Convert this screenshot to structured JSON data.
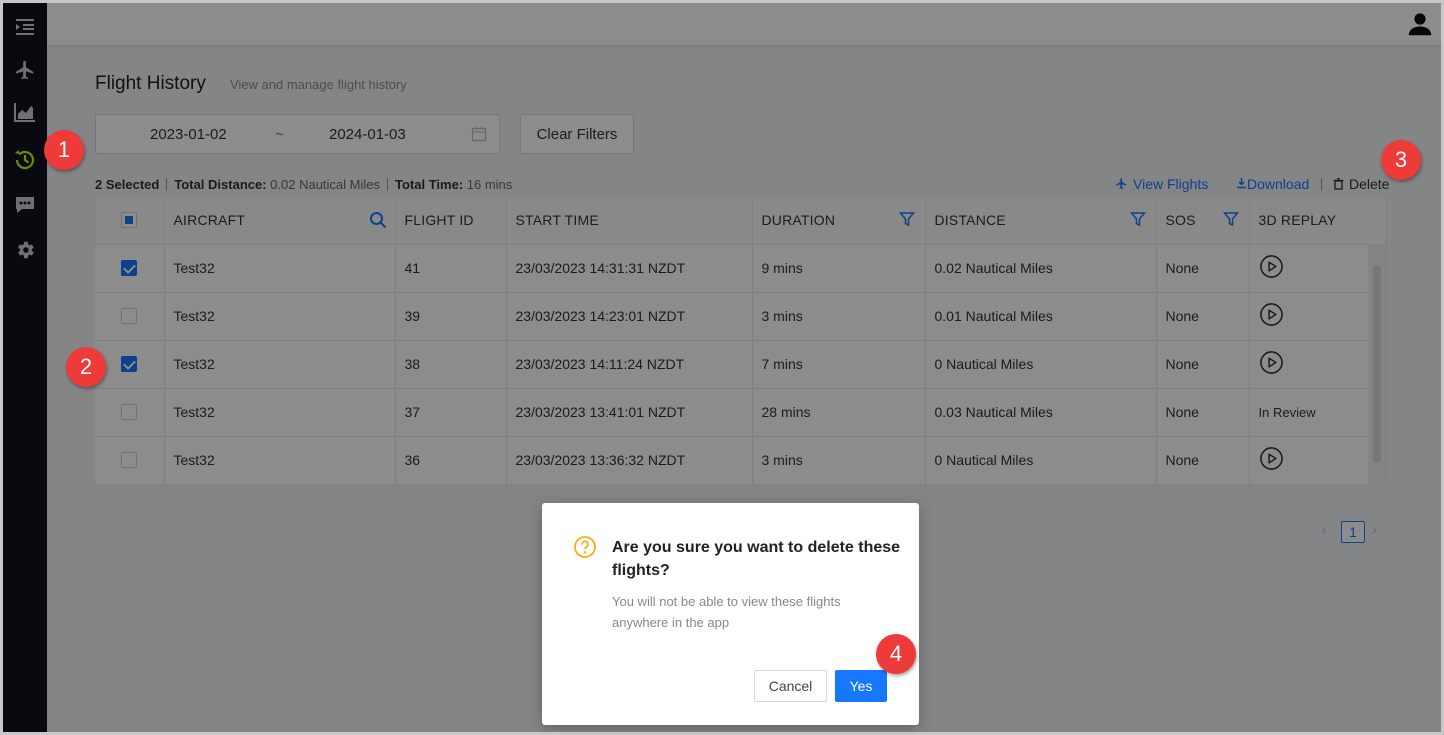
{
  "header": {
    "title": "Flight History",
    "subtitle": "View and manage flight history"
  },
  "sidebar": {
    "items": [
      {
        "icon": "menu-indent-icon"
      },
      {
        "icon": "airplane-icon"
      },
      {
        "icon": "area-chart-icon"
      },
      {
        "icon": "history-icon",
        "active": true
      },
      {
        "icon": "message-icon"
      },
      {
        "icon": "settings-icon"
      }
    ],
    "active_color": "#c6ff00"
  },
  "filters": {
    "date_from": "2023-01-02",
    "date_separator": "~",
    "date_to": "2024-01-03",
    "clear_label": "Clear Filters"
  },
  "summary": {
    "selected": "2 Selected",
    "distance_label": "Total Distance:",
    "distance_value": "0.02 Nautical Miles",
    "time_label": "Total Time:",
    "time_value": "16 mins"
  },
  "toolbar": {
    "view_flights": "View Flights",
    "download": "Download",
    "delete": "Delete"
  },
  "table": {
    "columns": [
      "AIRCRAFT",
      "FLIGHT ID",
      "START TIME",
      "DURATION",
      "DISTANCE",
      "SOS",
      "3D REPLAY"
    ],
    "rows": [
      {
        "checked": true,
        "aircraft": "Test32",
        "flight_id": "41",
        "start_time": "23/03/2023 14:31:31 NZDT",
        "duration": "9 mins",
        "distance": "0.02 Nautical Miles",
        "sos": "None",
        "replay": "play"
      },
      {
        "checked": false,
        "aircraft": "Test32",
        "flight_id": "39",
        "start_time": "23/03/2023 14:23:01 NZDT",
        "duration": "3 mins",
        "distance": "0.01 Nautical Miles",
        "sos": "None",
        "replay": "play"
      },
      {
        "checked": true,
        "aircraft": "Test32",
        "flight_id": "38",
        "start_time": "23/03/2023 14:11:24 NZDT",
        "duration": "7 mins",
        "distance": "0 Nautical Miles",
        "sos": "None",
        "replay": "play"
      },
      {
        "checked": false,
        "aircraft": "Test32",
        "flight_id": "37",
        "start_time": "23/03/2023 13:41:01 NZDT",
        "duration": "28 mins",
        "distance": "0.03 Nautical Miles",
        "sos": "None",
        "replay": "In Review"
      },
      {
        "checked": false,
        "aircraft": "Test32",
        "flight_id": "36",
        "start_time": "23/03/2023 13:36:32 NZDT",
        "duration": "3 mins",
        "distance": "0 Nautical Miles",
        "sos": "None",
        "replay": "play"
      }
    ]
  },
  "pagination": {
    "prev": "‹",
    "current": "1",
    "next": "›"
  },
  "modal": {
    "title": "Are you sure you want to delete these flights?",
    "body": "You will not be able to view these flights anywhere in the app",
    "cancel_label": "Cancel",
    "confirm_label": "Yes"
  },
  "callouts": [
    "1",
    "2",
    "3",
    "4"
  ],
  "colors": {
    "accent": "#1677ff",
    "callout": "#ef3a3a",
    "warning": "#faad14"
  }
}
